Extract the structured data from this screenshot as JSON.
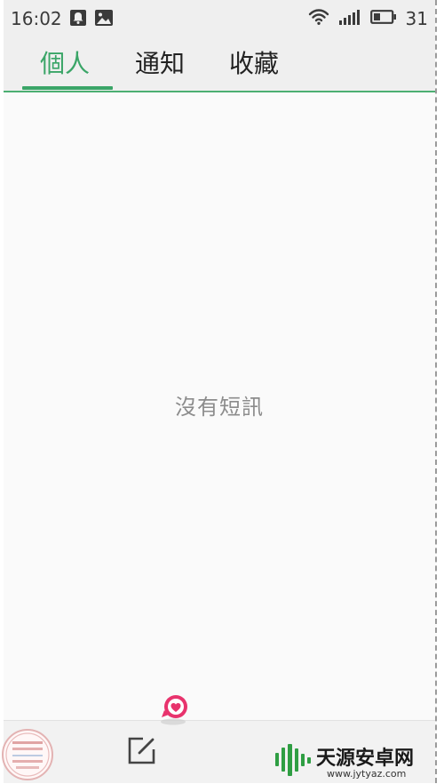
{
  "status_bar": {
    "time": "16:02",
    "battery_level": "31",
    "icons": [
      "notification-bell-icon",
      "image-icon",
      "wifi-icon",
      "signal-icon",
      "battery-icon"
    ]
  },
  "tabs": [
    {
      "label": "個人",
      "active": true
    },
    {
      "label": "通知",
      "active": false
    },
    {
      "label": "收藏",
      "active": false
    }
  ],
  "empty_state": {
    "message": "沒有短訊"
  },
  "bottom_bar": {
    "compose_icon": "compose-icon"
  },
  "colors": {
    "accent": "#3aa567",
    "status_background": "#efefef",
    "page_background": "#fafafa",
    "text_primary": "#222222",
    "text_muted": "#8c8c8c",
    "badge_pink": "#e8336d"
  },
  "watermark": {
    "logo_text": "天源安卓网",
    "url": "www.jytyaz.com"
  }
}
